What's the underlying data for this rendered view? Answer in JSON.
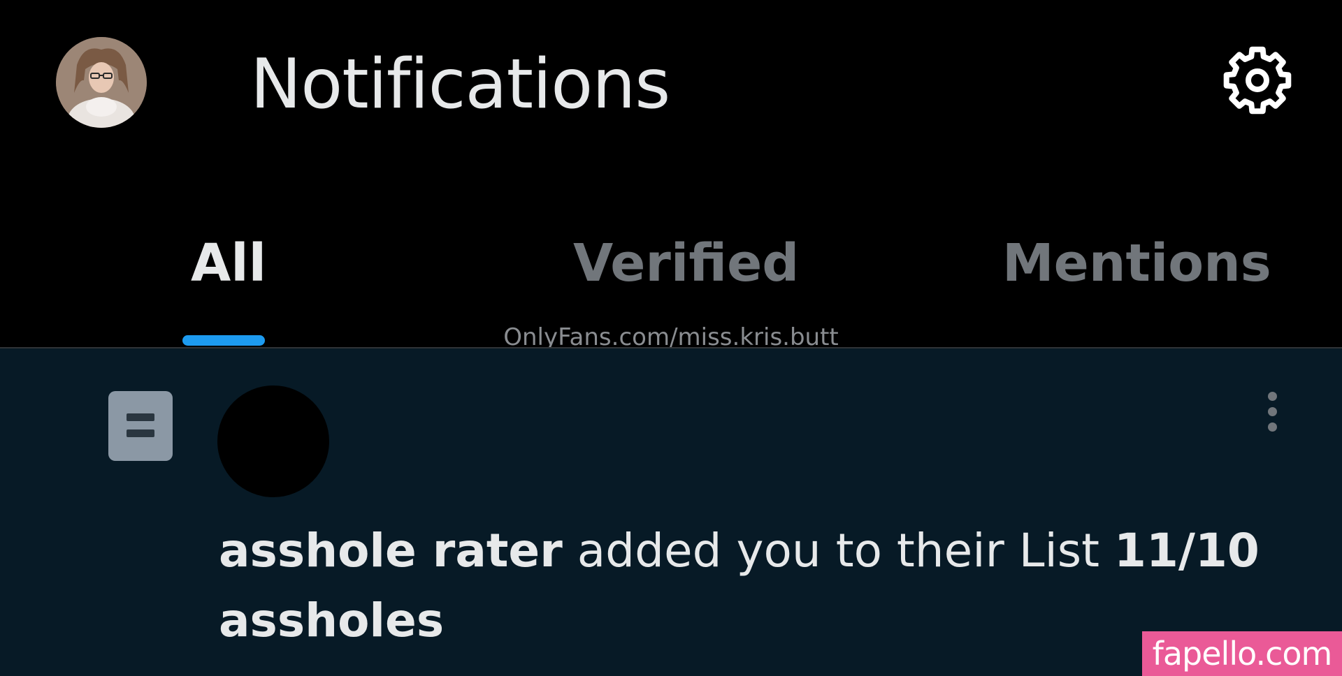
{
  "header": {
    "title": "Notifications",
    "avatar_icon": "profile-avatar",
    "settings_icon": "gear-icon"
  },
  "tabs": [
    {
      "label": "All",
      "active": true
    },
    {
      "label": "Verified",
      "active": false
    },
    {
      "label": "Mentions",
      "active": false
    }
  ],
  "watermark": "OnlyFans.com/miss.kris.butt",
  "notification": {
    "type_icon": "list-icon",
    "actor": "asshole rater",
    "action": " added you to their List ",
    "list_name": "11/10 assholes",
    "more_icon": "more-vertical-icon"
  },
  "site_badge": "fapello.com",
  "colors": {
    "accent": "#1d9bf0",
    "background": "#000000",
    "notification_background": "#071a26",
    "text_primary": "#e7e9ea",
    "text_secondary": "#71767b",
    "badge": "#ea5a97"
  }
}
